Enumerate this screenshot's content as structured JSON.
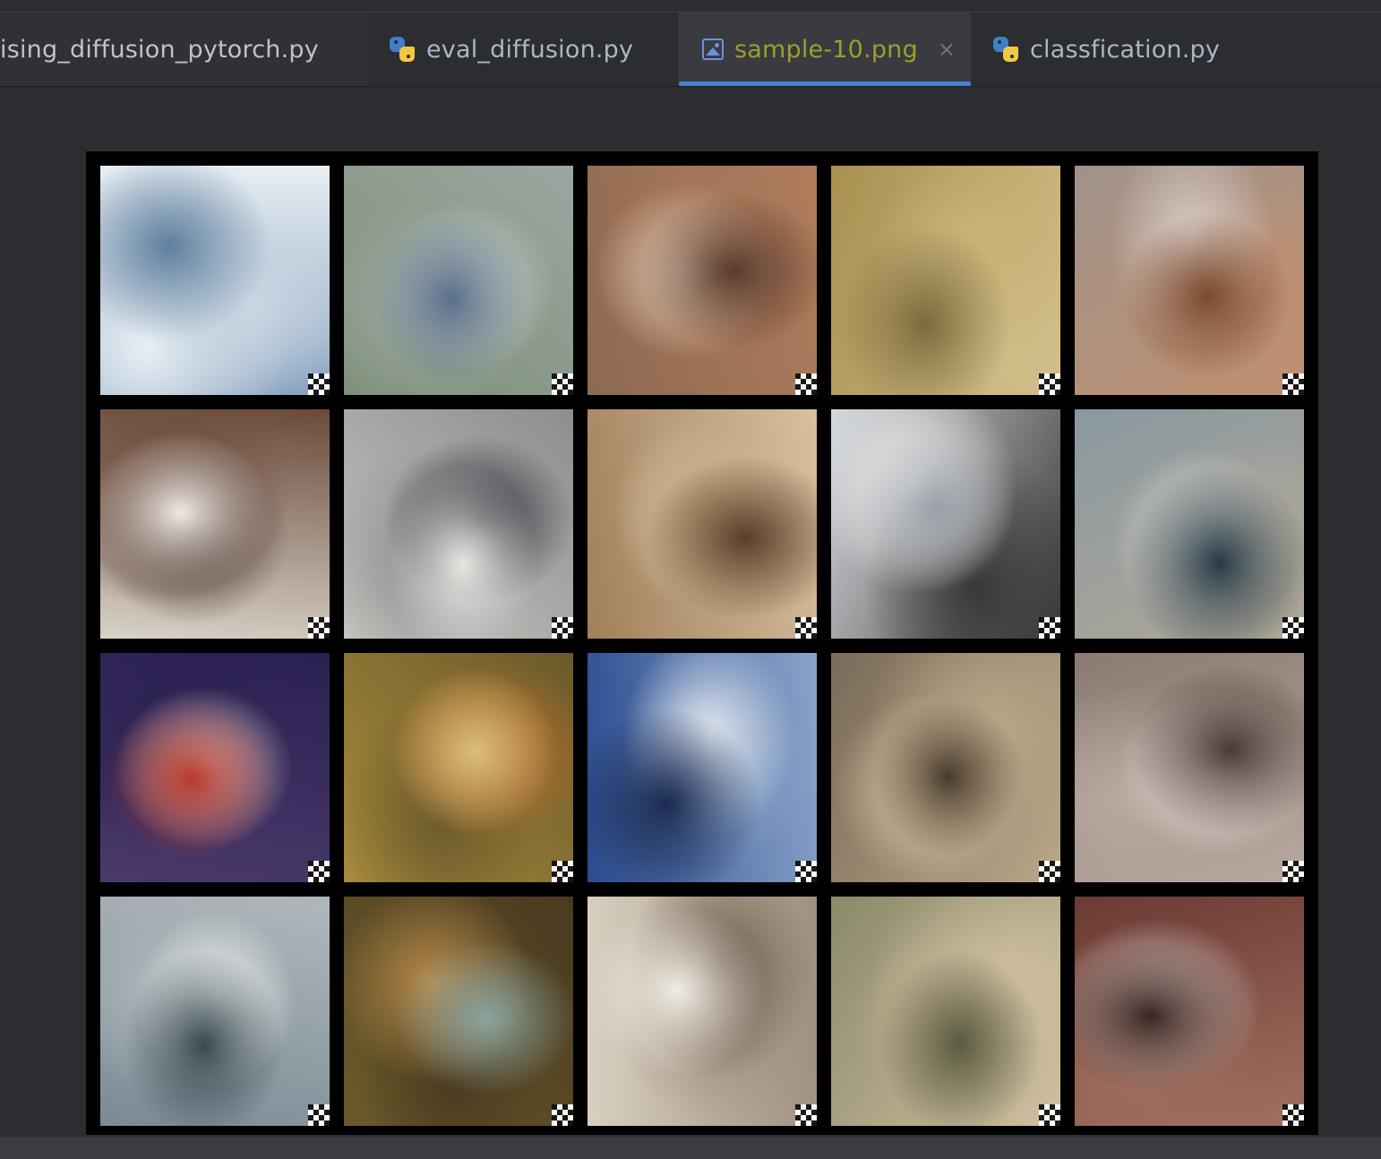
{
  "tabs": [
    {
      "label": "ising_diffusion_pytorch.py",
      "icon": "python-file-icon",
      "active": false
    },
    {
      "label": "eval_diffusion.py",
      "icon": "python-file-icon",
      "active": false
    },
    {
      "label": "sample-10.png",
      "icon": "image-file-icon",
      "active": true,
      "close": "×"
    },
    {
      "label": "classfication.py",
      "icon": "python-file-icon",
      "active": false
    }
  ],
  "image": {
    "filename": "sample-10.png",
    "grid": {
      "rows": 4,
      "cols": 5
    },
    "background": "#000000"
  },
  "colors": {
    "ide_background": "#2b2d30",
    "active_tab_text": "#9e9e2b",
    "tab_text": "#a9b7c6",
    "active_underline": "#4a80d0"
  }
}
